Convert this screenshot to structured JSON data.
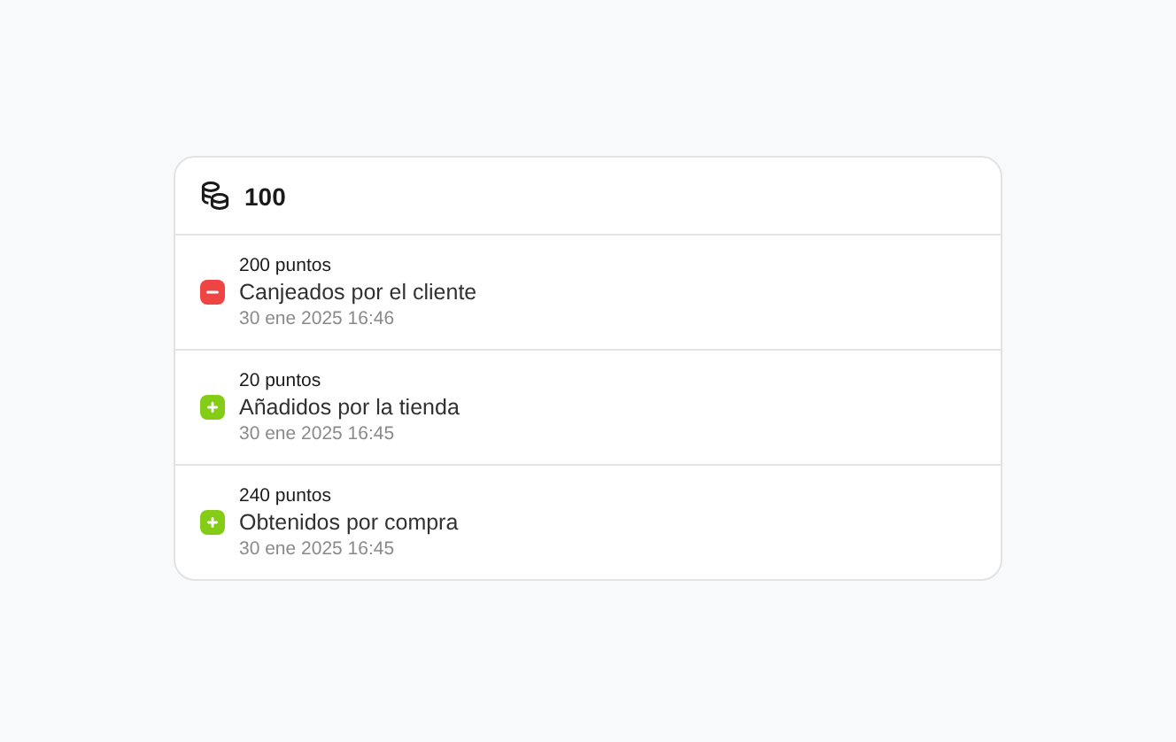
{
  "balance": {
    "value": "100"
  },
  "entries": [
    {
      "kind": "minus",
      "points": "200 puntos",
      "description": "Canjeados por el cliente",
      "date": "30 ene 2025 16:46"
    },
    {
      "kind": "plus",
      "points": "20 puntos",
      "description": "Añadidos por la tienda",
      "date": "30 ene 2025 16:45"
    },
    {
      "kind": "plus",
      "points": "240 puntos",
      "description": "Obtenidos por compra",
      "date": "30 ene 2025 16:45"
    }
  ]
}
